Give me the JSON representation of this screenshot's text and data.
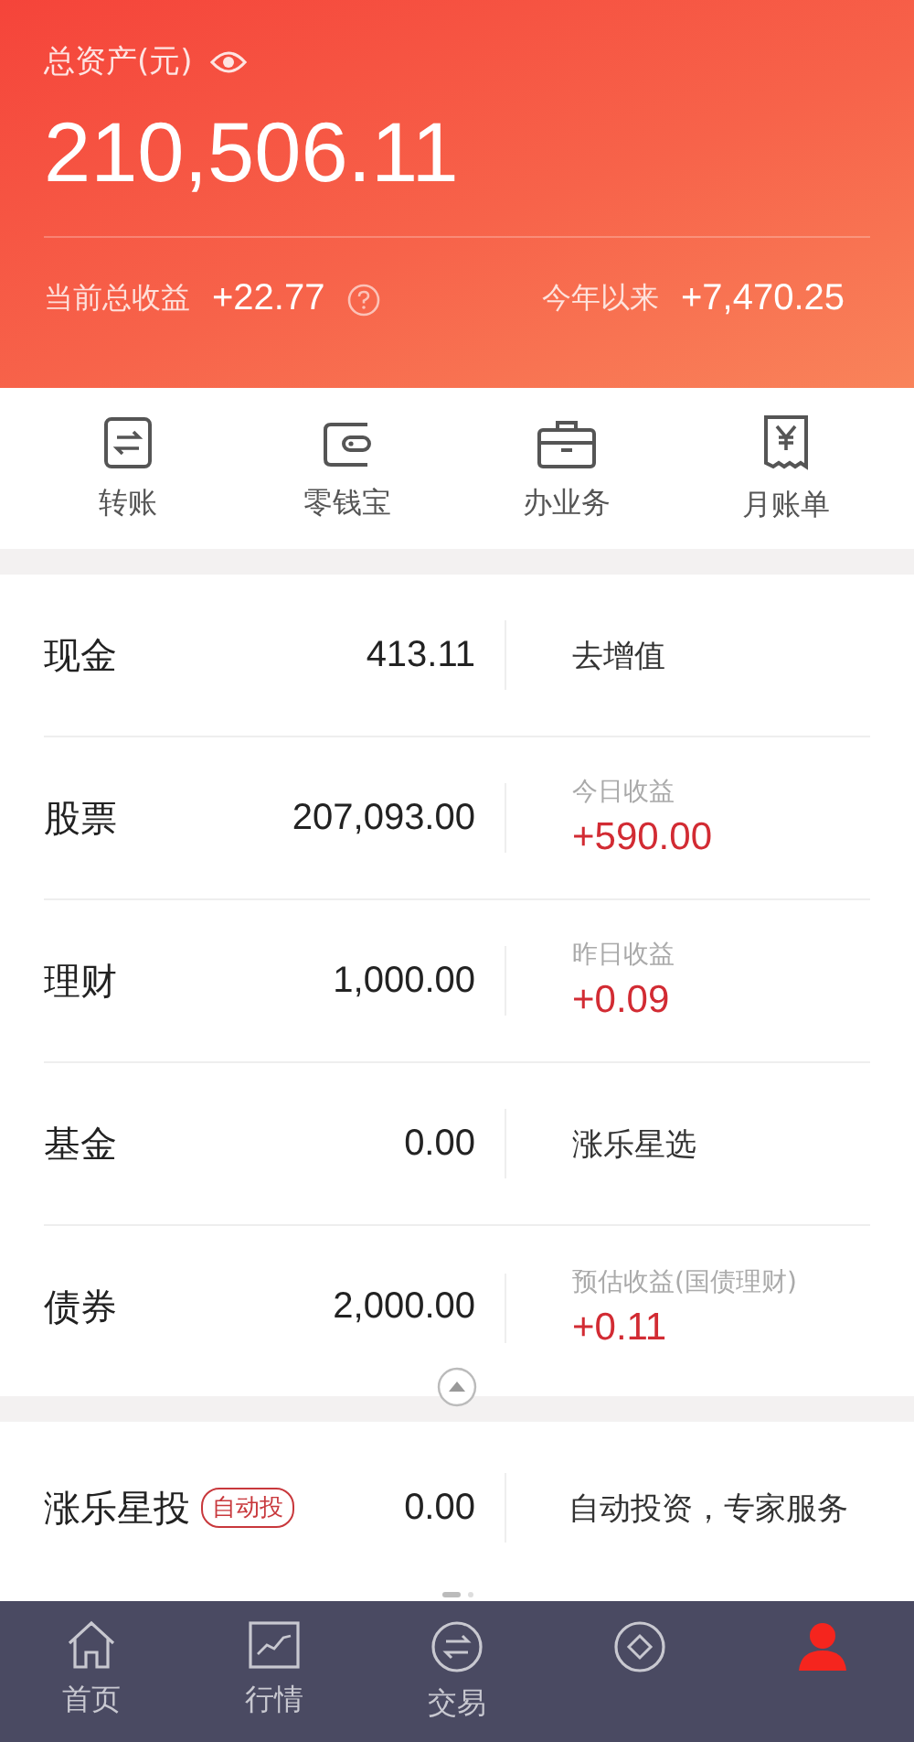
{
  "header": {
    "title": "总资产(元)",
    "total": "210,506.11",
    "current_profit_label": "当前总收益",
    "current_profit": "+22.77",
    "year_label": "今年以来",
    "year_profit": "+7,470.25"
  },
  "shortcuts": [
    {
      "kind": "transfer",
      "label": "转账"
    },
    {
      "kind": "wallet",
      "label": "零钱宝"
    },
    {
      "kind": "briefcase",
      "label": "办业务"
    },
    {
      "kind": "bill",
      "label": "月账单"
    }
  ],
  "assets": [
    {
      "name": "现金",
      "value": "413.11",
      "side": {
        "kind": "link",
        "text": "去增值"
      }
    },
    {
      "name": "股票",
      "value": "207,093.00",
      "side": {
        "kind": "profit",
        "label": "今日收益",
        "value": "+590.00"
      }
    },
    {
      "name": "理财",
      "value": "1,000.00",
      "side": {
        "kind": "profit",
        "label": "昨日收益",
        "value": "+0.09"
      }
    },
    {
      "name": "基金",
      "value": "0.00",
      "side": {
        "kind": "link",
        "text": "涨乐星选"
      }
    },
    {
      "name": "债券",
      "value": "2,000.00",
      "side": {
        "kind": "profit",
        "label": "预估收益(国债理财)",
        "value": "+0.11"
      }
    }
  ],
  "promo": {
    "name": "涨乐星投",
    "tag": "自动投",
    "value": "0.00",
    "text": "自动投资，专家服务"
  },
  "tabs": [
    {
      "kind": "home",
      "label": "首页",
      "selected": false
    },
    {
      "kind": "market",
      "label": "行情",
      "selected": false
    },
    {
      "kind": "trade",
      "label": "交易",
      "selected": false
    },
    {
      "kind": "finance",
      "selected": false
    },
    {
      "kind": "me",
      "selected": true
    }
  ]
}
